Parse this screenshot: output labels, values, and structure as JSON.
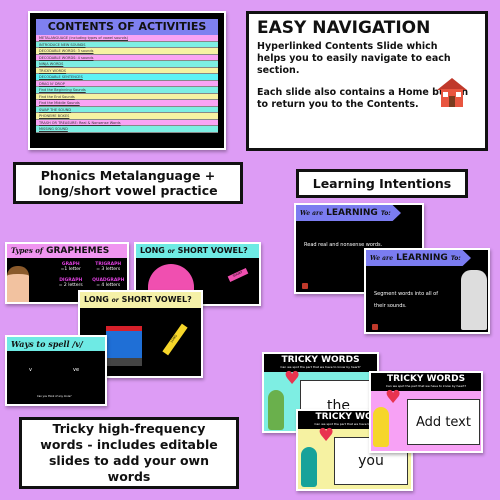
{
  "contents": {
    "title": "CONTENTS OF ACTIVITIES",
    "rows": [
      {
        "text": "METALANGUAGE (including types of vowel sounds)",
        "color": "#f9a3f4"
      },
      {
        "text": "INTRODUCE NEW SOUNDS",
        "color": "#7deee3"
      },
      {
        "text": "DECODABLE WORDS: 3 sounds",
        "color": "#f6f2a2"
      },
      {
        "text": "DECODABLE WORDS: 4 sounds",
        "color": "#f9a3f4"
      },
      {
        "text": "NINJA WORDS",
        "color": "#7deee3"
      },
      {
        "text": "TRICKY WORDS",
        "color": "#f6f2a2"
      },
      {
        "text": "DECODABLE SENTENCES",
        "color": "#5ff2f5"
      },
      {
        "text": "DRAG N' DROP",
        "color": "#f9a3f4"
      },
      {
        "text": "Find the Beginning Sounds",
        "color": "#7deee3"
      },
      {
        "text": "Find the End Sounds",
        "color": "#f6f2a2"
      },
      {
        "text": "Find the Middle Sounds",
        "color": "#f9a3f4"
      },
      {
        "text": "SWAP THE SOUND",
        "color": "#7deee3"
      },
      {
        "text": "PHONEME BOXES",
        "color": "#f6f2a2"
      },
      {
        "text": "TRASH OR TREASURE: Real & Nonsense Words",
        "color": "#f9a3f4"
      },
      {
        "text": "MISSING SOUND",
        "color": "#7deee3"
      }
    ]
  },
  "navigation": {
    "title": "EASY NAVIGATION",
    "text1": "Hyperlinked Contents Slide which helps you to easily navigate to each section.",
    "text2": "Each slide also contains a Home button to return you to the Contents.",
    "icon": "house-icon"
  },
  "labels": {
    "phonics": "Phonics Metalanguage + long/short vowel practice",
    "learning": "Learning Intentions",
    "tricky": "Tricky high-frequency words - includes editable slides to add your own words"
  },
  "graphemes": {
    "title_script": "Types of",
    "title": "GRAPHEMES",
    "items": [
      {
        "name": "GRAPH",
        "desc": "=1 letter"
      },
      {
        "name": "TRIGRAPH",
        "desc": "= 3 letters"
      },
      {
        "name": "DIGRAPH",
        "desc": "= 2 letters"
      },
      {
        "name": "QUADGRAPH",
        "desc": "= 4 letters"
      }
    ]
  },
  "vowel1": {
    "title_a": "LONG",
    "title_or": "or",
    "title_b": "SHORT VOWEL?",
    "pencil": "SHORT"
  },
  "vowel2": {
    "title_a": "LONG",
    "title_or": "or",
    "title_b": "SHORT VOWEL?",
    "pencil": "LONG"
  },
  "spell": {
    "title": "Ways to spell /v/",
    "items": [
      "v",
      "ve"
    ],
    "footer": "Can you think of any more?"
  },
  "learning": [
    {
      "script": "We are",
      "title": "LEARNING",
      "to": "To:",
      "text": "Read real and nonsense words."
    },
    {
      "script": "We are",
      "title": "LEARNING",
      "to": "To:",
      "text": "Segment words into all of their sounds."
    }
  ],
  "tricky": [
    {
      "title": "TRICKY WORDS",
      "sub": "Can we spot the part that we have to know by heart?",
      "word": "the",
      "bg": "#7eeee3"
    },
    {
      "title": "TRICKY WORDS",
      "sub": "Can we spot the part that we have to know by heart?",
      "word": "you",
      "bg": "#f6f2a2"
    },
    {
      "title": "TRICKY WORDS",
      "sub": "Can we spot the part that we have to know by heart?",
      "word": "Add text",
      "bg": "#f7a1f5"
    }
  ],
  "colors": {
    "background": "#dd9cf5",
    "contents_header": "#7f80f0",
    "learning_banner": "#7b7cf0",
    "grapheme_pink": "#f095f0",
    "vowel_cyan": "#6eeae4",
    "vowel_yellow": "#f5f1a8"
  }
}
